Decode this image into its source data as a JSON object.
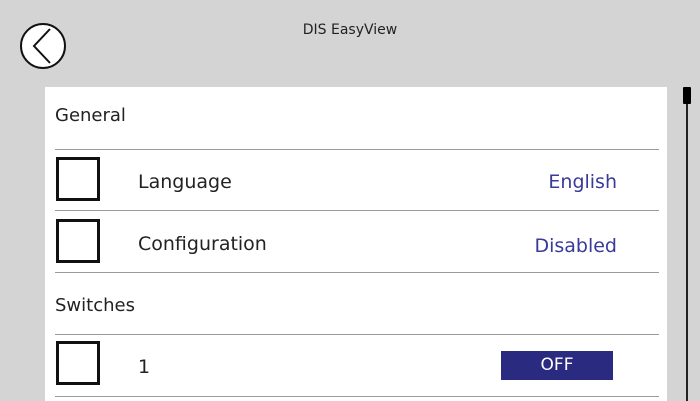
{
  "header": {
    "title": "DIS EasyView",
    "back_icon": "chevron-left-icon"
  },
  "sections": {
    "general": {
      "title": "General",
      "rows": [
        {
          "label": "Language",
          "value": "English",
          "checked": false
        },
        {
          "label": "Configuration",
          "value": "Disabled",
          "checked": false
        }
      ]
    },
    "switches": {
      "title": "Switches",
      "rows": [
        {
          "label": "1",
          "toggle": "OFF",
          "checked": false
        }
      ]
    }
  },
  "colors": {
    "background": "#d4d4d4",
    "panel": "#ffffff",
    "value_text": "#3a3a9a",
    "toggle_bg": "#2a2a80"
  }
}
